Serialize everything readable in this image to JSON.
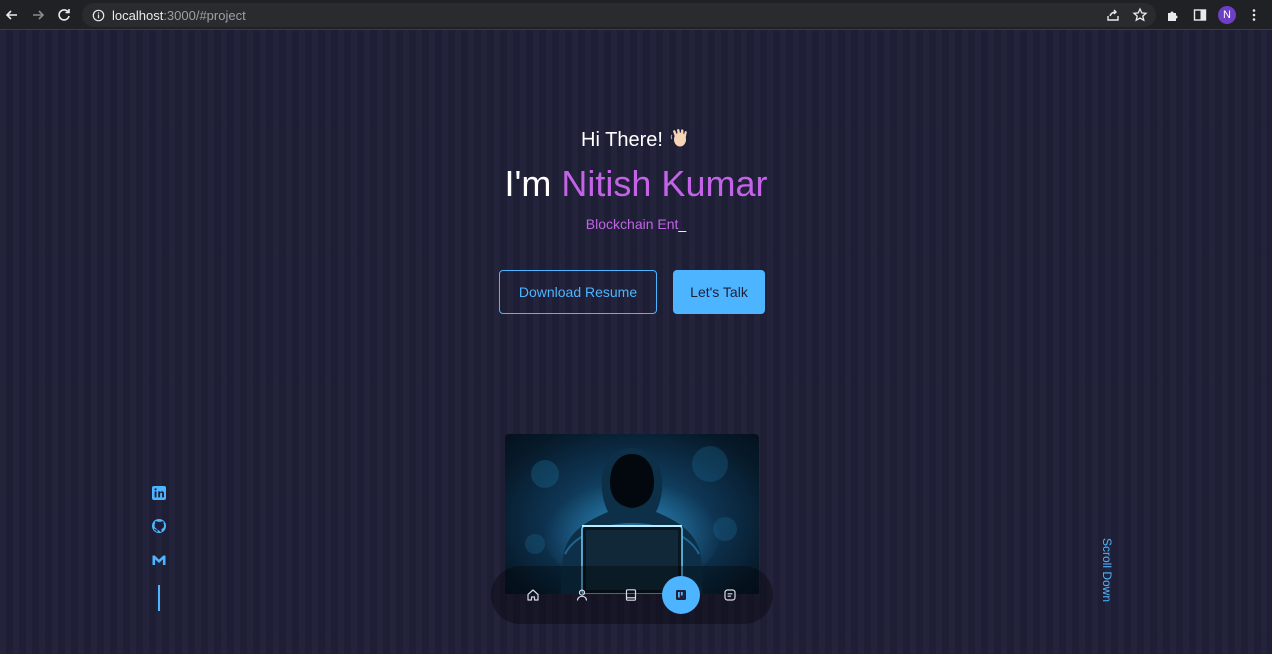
{
  "browser": {
    "url_host": "localhost",
    "url_rest": ":3000/#project",
    "profile_initial": "N"
  },
  "hero": {
    "greeting": "Hi There!",
    "wave_emoji": "👋🏻",
    "intro": "I'm ",
    "name": "Nitish Kumar",
    "typed_text": "Blockchain Ent",
    "cursor": "_"
  },
  "buttons": {
    "download_resume": "Download Resume",
    "lets_talk": "Let's Talk"
  },
  "scroll_label": "Scroll Down",
  "socials": [
    "linkedin-icon",
    "github-icon",
    "gmail-icon"
  ],
  "nav_items": [
    "home-icon",
    "user-icon",
    "book-icon",
    "project-board-icon",
    "message-icon"
  ],
  "nav_active": "project-board-icon",
  "colors": {
    "background": "#1f1f38",
    "accent": "#4db5ff",
    "name_purple": "#c462e8"
  }
}
